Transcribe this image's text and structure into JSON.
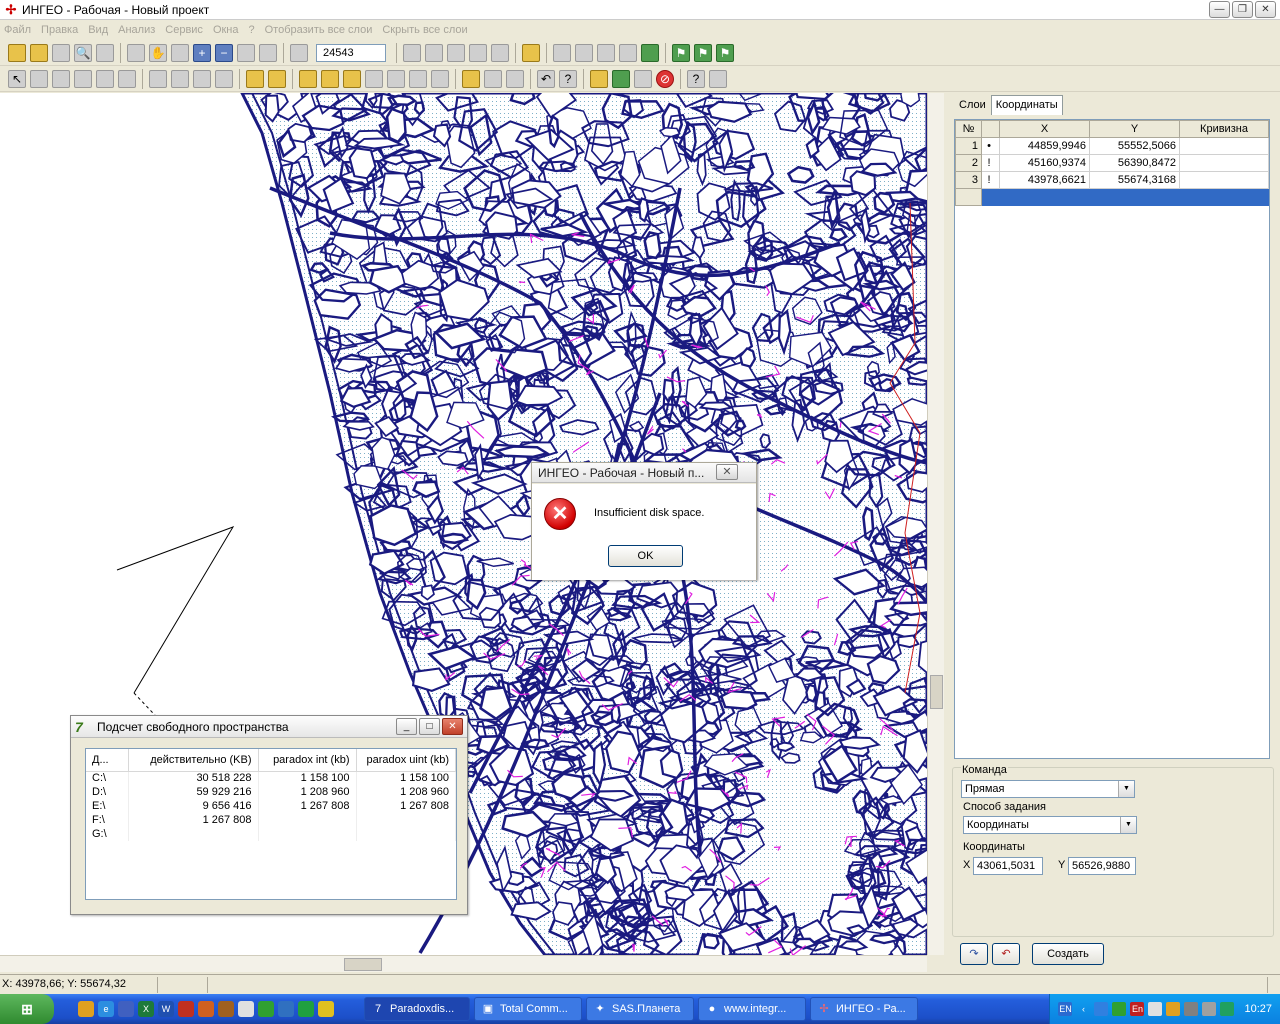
{
  "window": {
    "title": "ИНГЕО - Рабочая - Новый проект"
  },
  "menu": [
    "Файл",
    "Правка",
    "Вид",
    "Анализ",
    "Сервис",
    "Окна",
    "?",
    "Отобразить все слои",
    "Скрыть все слои"
  ],
  "toolbar": {
    "scale_value": "24543"
  },
  "right_panel": {
    "tabs": [
      "Слои",
      "Координаты"
    ],
    "active_tab": "Координаты",
    "table": {
      "headers": [
        "№",
        "",
        "X",
        "Y",
        "Кривизна"
      ],
      "rows": [
        {
          "n": "1",
          "mark": "•",
          "x": "44859,9946",
          "y": "55552,5066",
          "curv": ""
        },
        {
          "n": "2",
          "mark": "!",
          "x": "45160,9374",
          "y": "56390,8472",
          "curv": ""
        },
        {
          "n": "3",
          "mark": "!",
          "x": "43978,6621",
          "y": "55674,3168",
          "curv": ""
        }
      ]
    },
    "command_label": "Команда",
    "command_value": "Прямая",
    "method_label": "Способ задания",
    "method_value": "Координаты",
    "coords_label": "Координаты",
    "x_label": "X",
    "x_value": "43061,5031",
    "y_label": "Y",
    "y_value": "56526,9880",
    "create_button": "Создать"
  },
  "dialog": {
    "title": "ИНГЕО - Рабочая - Новый п...",
    "message": "Insufficient disk space.",
    "ok_label": "OK"
  },
  "free_space_window": {
    "title": "Подсчет свободного пространства",
    "headers": [
      "Д...",
      "действительно (KB)",
      "paradox int (kb)",
      "paradox uint (kb)"
    ],
    "rows": [
      [
        "C:\\",
        "30 518 228",
        "1 158 100",
        "1 158 100"
      ],
      [
        "D:\\",
        "59 929 216",
        "1 208 960",
        "1 208 960"
      ],
      [
        "E:\\",
        "9 656 416",
        "1 267 808",
        "1 267 808"
      ],
      [
        "F:\\",
        "1 267 808",
        "",
        ""
      ],
      [
        "G:\\",
        "",
        "",
        ""
      ]
    ]
  },
  "status": {
    "coords": "X: 43978,66; Y: 55674,32"
  },
  "taskbar": {
    "tasks": [
      "Paradoxdis...",
      "Total Comm...",
      "SAS.Планета",
      "www.integr...",
      "ИНГЕО - Ра..."
    ],
    "lang": "EN",
    "lang2": "En",
    "clock": "10:27"
  },
  "colors": {
    "map_lines": "#1a1a80",
    "map_magenta": "#e020e0",
    "selection": "#316ac5"
  }
}
